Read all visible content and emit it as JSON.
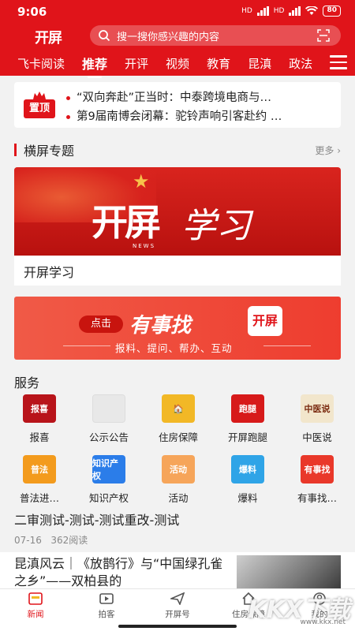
{
  "status": {
    "time": "9:06",
    "battery": "80",
    "net1": "HD",
    "net2": "HD"
  },
  "header": {
    "logo": "开屏",
    "search_placeholder": "搜一搜你感兴趣的内容",
    "tabs": [
      "飞卡阅读",
      "推荐",
      "开评",
      "视频",
      "教育",
      "昆滇",
      "政法"
    ],
    "active_tab": "推荐"
  },
  "pinned": {
    "badge": "置顶",
    "items": [
      "“双向奔赴”正当时：中泰跨境电商与…",
      "第9届南博会闭幕：驼铃声响引客赴约 …"
    ]
  },
  "section": {
    "title": "横屏专题",
    "more": "更多"
  },
  "banner": {
    "logo_text": "开屏",
    "news": "NEWS",
    "script_text": "学习",
    "caption": "开屏学习"
  },
  "ad": {
    "click": "点击",
    "headline": "有事找",
    "logo": "开屏",
    "sub": "报料、提问、帮办、互动"
  },
  "services": {
    "title": "服务",
    "items": [
      {
        "label": "报喜",
        "icon": "baoxi-icon",
        "color": "#b8141a",
        "glyph": "报喜"
      },
      {
        "label": "公示公告",
        "icon": "image-placeholder-icon",
        "color": "#e8e8e8",
        "glyph": ""
      },
      {
        "label": "住房保障",
        "icon": "housing-icon",
        "color": "#f2b826",
        "glyph": "🏠"
      },
      {
        "label": "开屏跑腿",
        "icon": "errand-icon",
        "color": "#d71a1a",
        "glyph": "跑腿"
      },
      {
        "label": "中医说",
        "icon": "tcm-icon",
        "color": "#f2e6cc",
        "glyph": "中医说"
      },
      {
        "label": "普法进…",
        "icon": "law-icon",
        "color": "#f39b1d",
        "glyph": "普法"
      },
      {
        "label": "知识产权",
        "icon": "ip-icon",
        "color": "#2b7de9",
        "glyph": "知识产权"
      },
      {
        "label": "活动",
        "icon": "medal-icon",
        "color": "#f6a55a",
        "glyph": "活动"
      },
      {
        "label": "爆料",
        "icon": "mic-icon",
        "color": "#2fa4e7",
        "glyph": "爆料"
      },
      {
        "label": "有事找…",
        "icon": "help-icon",
        "color": "#e9382a",
        "glyph": "有事找"
      }
    ]
  },
  "articles": [
    {
      "title": "二审测试-测试-测试重改-测试",
      "date": "07-16",
      "reads": "362阅读"
    },
    {
      "title": "昆滇风云｜《放鹊行》与“中国绿孔雀之乡”——双柏县的"
    }
  ],
  "bottom_nav": {
    "items": [
      "新闻",
      "拍客",
      "开屏号",
      "住房保障",
      "我的"
    ],
    "active": "新闻"
  },
  "watermark": {
    "big": "KKX下载",
    "small": "www.kkx.net"
  }
}
